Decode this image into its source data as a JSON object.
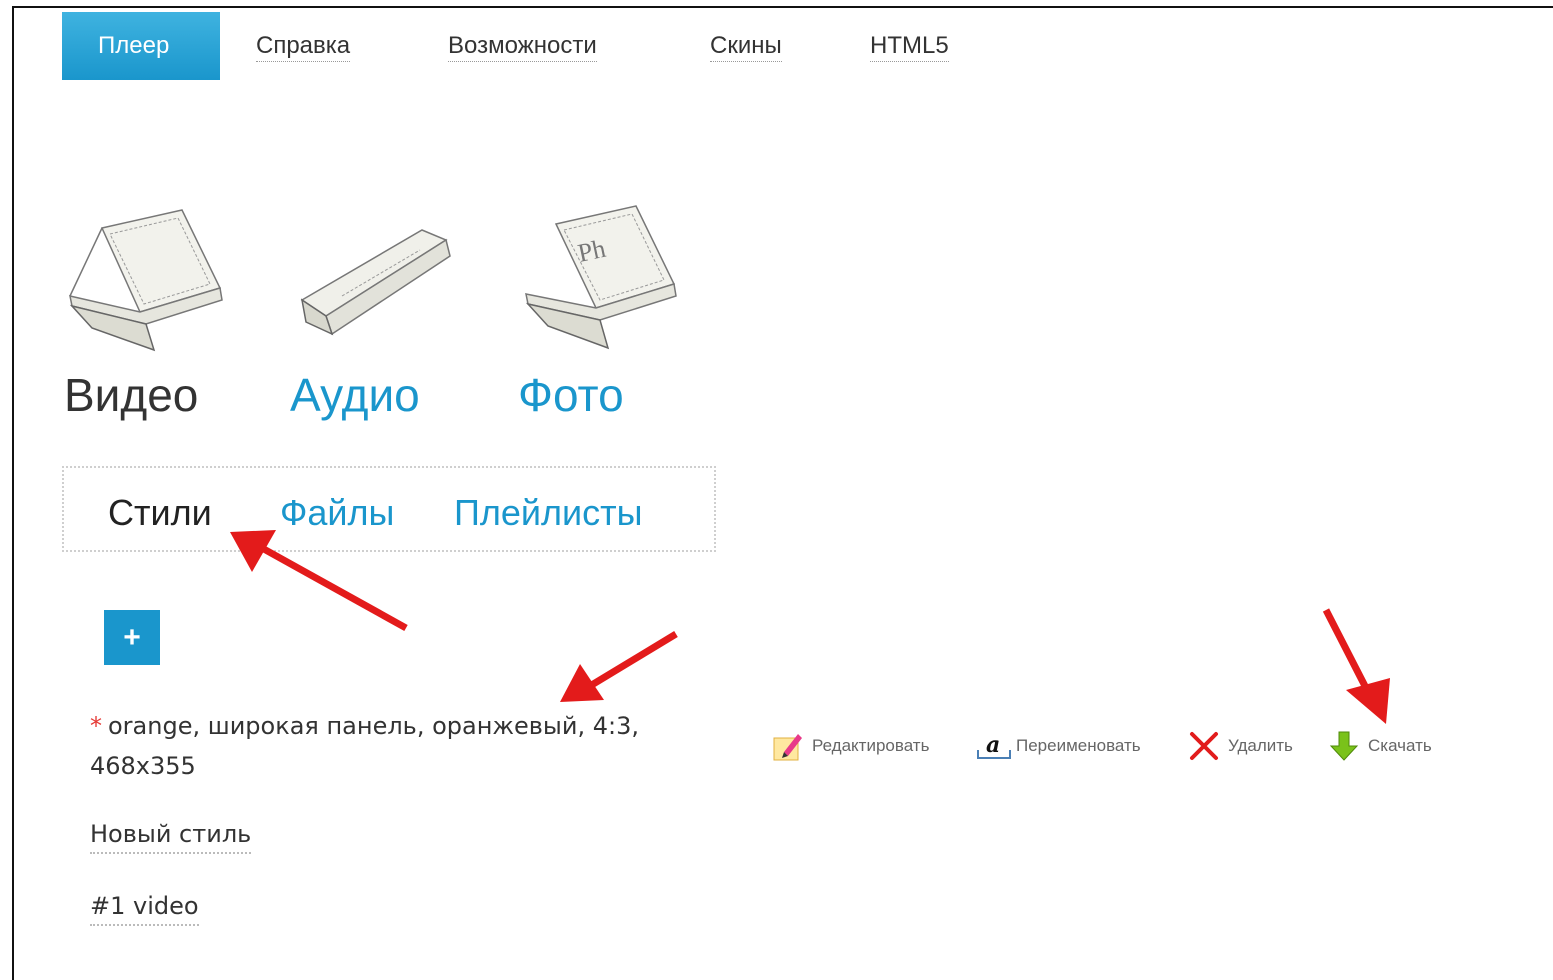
{
  "topnav": {
    "items": [
      {
        "label": "Плеер",
        "active": true
      },
      {
        "label": "Справка"
      },
      {
        "label": "Возможности"
      },
      {
        "label": "Скины"
      },
      {
        "label": "HTML5"
      }
    ]
  },
  "media": {
    "video": {
      "label": "Видео",
      "icon": "video-player-icon"
    },
    "audio": {
      "label": "Аудио",
      "icon": "audio-player-icon"
    },
    "photo": {
      "label": "Фото",
      "icon": "photo-player-icon",
      "icon_text": "Ph"
    }
  },
  "subtabs": {
    "styles": "Стили",
    "files": "Файлы",
    "playlists": "Плейлисты"
  },
  "add_button": {
    "label": "+",
    "icon": "plus-icon"
  },
  "styles_list": {
    "current": {
      "marker": "*",
      "description": "orange, широкая панель, оранжевый, 4:3, 468x355"
    },
    "actions": {
      "edit": {
        "label": "Редактировать",
        "icon": "pencil-icon"
      },
      "rename": {
        "label": "Переименовать",
        "icon": "rename-icon"
      },
      "delete": {
        "label": "Удалить",
        "icon": "close-icon"
      },
      "download": {
        "label": "Скачать",
        "icon": "download-arrow-icon"
      }
    },
    "items": [
      {
        "label": "Новый стиль"
      },
      {
        "label": "#1 video"
      }
    ]
  },
  "colors": {
    "accent": "#1a96cc",
    "annotation_arrow": "#e31b1b",
    "star": "#e53935"
  }
}
